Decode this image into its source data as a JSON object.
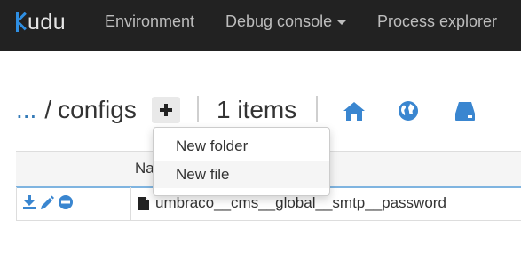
{
  "nav": {
    "brand": "udu",
    "items": [
      {
        "label": "Environment"
      },
      {
        "label": "Debug console"
      },
      {
        "label": "Process explorer"
      }
    ]
  },
  "breadcrumb": {
    "ellipsis": "...",
    "separator": "/",
    "current": "configs"
  },
  "toolbar": {
    "items_count": "1 items"
  },
  "menu": {
    "items": [
      {
        "label": "New folder"
      },
      {
        "label": "New file"
      }
    ]
  },
  "table": {
    "header_partial": "Na",
    "rows": [
      {
        "name": "umbraco__cms__global__smtp__password"
      }
    ]
  },
  "colors": {
    "navbar": "#222222",
    "accent": "#337ab7",
    "icon_blue": "#3a86d0"
  }
}
